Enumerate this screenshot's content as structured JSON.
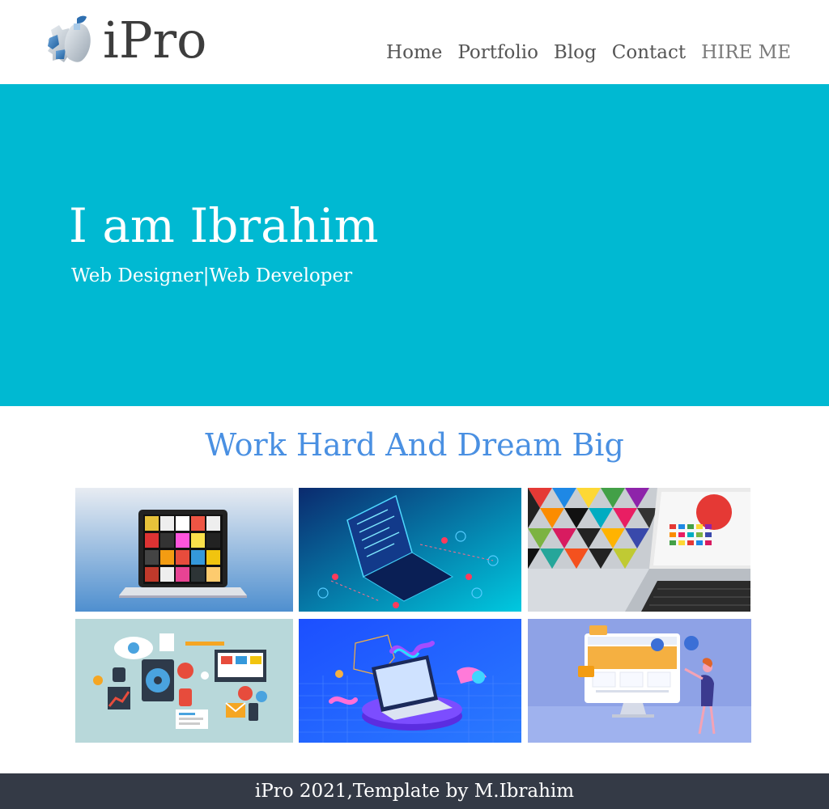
{
  "header": {
    "logo_text": "iPro",
    "logo_icon": "gear-apple-logo-icon",
    "nav": [
      {
        "label": "Home"
      },
      {
        "label": "Portfolio"
      },
      {
        "label": "Blog"
      },
      {
        "label": "Contact"
      },
      {
        "label": "HIRE ME"
      }
    ]
  },
  "hero": {
    "title": "I am Ibrahim",
    "subtitle": "Web Designer|Web Developer",
    "background_color": "#00b9d2"
  },
  "portfolio": {
    "title": "Work Hard And Dream Big",
    "title_color": "#4a90e2",
    "tiles": [
      {
        "icon": "laptop-gallery-image"
      },
      {
        "icon": "laptop-code-neon-image"
      },
      {
        "icon": "laptop-colorful-image"
      },
      {
        "icon": "tech-devices-flat-image"
      },
      {
        "icon": "isometric-laptop-image"
      },
      {
        "icon": "web-design-illustration-image"
      }
    ]
  },
  "footer": {
    "text": "iPro 2021,Template by M.Ibrahim",
    "background_color": "#343a46"
  }
}
